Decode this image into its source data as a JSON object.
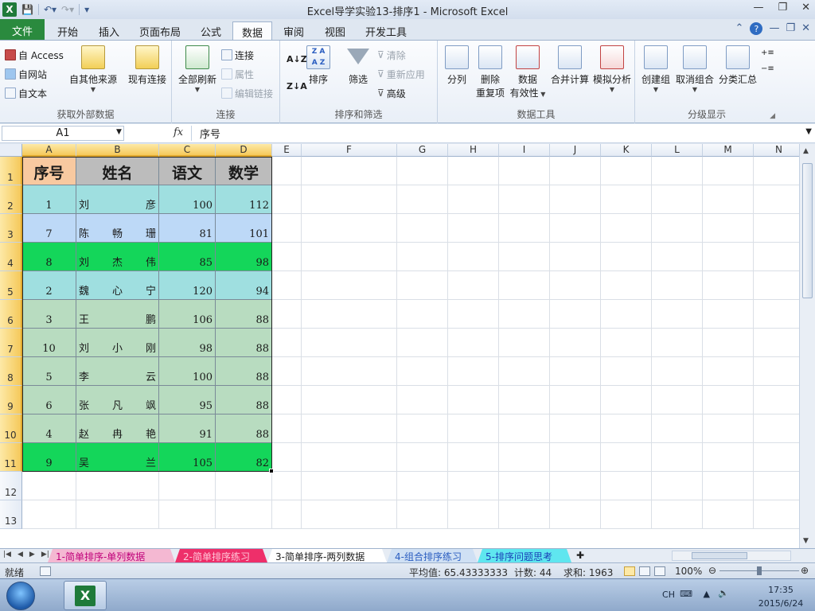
{
  "window": {
    "title": "Excel导学实验13-排序1  -  Microsoft Excel",
    "controls": [
      "—",
      "❐",
      "✕"
    ]
  },
  "ribbon_tabs": [
    "文件",
    "开始",
    "插入",
    "页面布局",
    "公式",
    "数据",
    "审阅",
    "视图",
    "开发工具"
  ],
  "ribbon": {
    "external": {
      "access": "自 Access",
      "web": "自网站",
      "text": "自文本",
      "other": "自其他来源",
      "existing": "现有连接",
      "label": "获取外部数据"
    },
    "connections": {
      "refresh_all": "全部刷新",
      "connections": "连接",
      "properties": "属性",
      "edit_links": "编辑链接",
      "label": "连接"
    },
    "sort_filter": {
      "sort": "排序",
      "filter": "筛选",
      "clear": "清除",
      "reapply": "重新应用",
      "advanced": "高级",
      "label": "排序和筛选"
    },
    "data_tools": {
      "text_to_columns": "分列",
      "remove_dup_1": "删除",
      "remove_dup_2": "重复项",
      "validation_1": "数据",
      "validation_2": "有效性",
      "consolidate": "合并计算",
      "what_if": "模拟分析",
      "label": "数据工具"
    },
    "outline": {
      "group": "创建组",
      "ungroup": "取消组合",
      "subtotal": "分类汇总",
      "label": "分级显示"
    }
  },
  "formula_bar": {
    "name_box": "A1",
    "fx": "fx",
    "content": "序号"
  },
  "columns": [
    "A",
    "B",
    "C",
    "D",
    "E",
    "F",
    "G",
    "H",
    "I",
    "J",
    "K",
    "L",
    "M",
    "N"
  ],
  "rows": [
    "1",
    "2",
    "3",
    "4",
    "5",
    "6",
    "7",
    "8",
    "9",
    "10",
    "11",
    "12",
    "13"
  ],
  "table": {
    "headers": [
      "序号",
      "姓名",
      "语文",
      "数学"
    ],
    "rows": [
      {
        "no": "1",
        "name": [
          "刘",
          "彦"
        ],
        "chinese": "100",
        "math": "112",
        "fill": "#9fdfe0"
      },
      {
        "no": "7",
        "name": [
          "陈",
          "畅",
          "珊"
        ],
        "chinese": "81",
        "math": "101",
        "fill": "#bdd9f7"
      },
      {
        "no": "8",
        "name": [
          "刘",
          "杰",
          "伟"
        ],
        "chinese": "85",
        "math": "98",
        "fill": "#14d65a"
      },
      {
        "no": "2",
        "name": [
          "魏",
          "心",
          "宁"
        ],
        "chinese": "120",
        "math": "94",
        "fill": "#9fdfe0"
      },
      {
        "no": "3",
        "name": [
          "王",
          "鹏"
        ],
        "chinese": "106",
        "math": "88",
        "fill": "#b8dcc0"
      },
      {
        "no": "10",
        "name": [
          "刘",
          "小",
          "刚"
        ],
        "chinese": "98",
        "math": "88",
        "fill": "#b8dcc0"
      },
      {
        "no": "5",
        "name": [
          "李",
          "云"
        ],
        "chinese": "100",
        "math": "88",
        "fill": "#b8dcc0"
      },
      {
        "no": "6",
        "name": [
          "张",
          "凡",
          "飒"
        ],
        "chinese": "95",
        "math": "88",
        "fill": "#b8dcc0"
      },
      {
        "no": "4",
        "name": [
          "赵",
          "冉",
          "艳"
        ],
        "chinese": "91",
        "math": "88",
        "fill": "#b8dcc0"
      },
      {
        "no": "9",
        "name": [
          "吴",
          "兰"
        ],
        "chinese": "105",
        "math": "82",
        "fill": "#14d65a"
      }
    ],
    "header_fills": [
      "#f8c9a0",
      "#bcbcbc",
      "#bcbcbc",
      "#bcbcbc"
    ]
  },
  "sheets": [
    {
      "name": "1-简单排序-单列数据",
      "color": "#f4b8d2",
      "text": "#c0007a"
    },
    {
      "name": "2-简单排序练习",
      "color": "#ee2f6a",
      "text": "#ffc6d8"
    },
    {
      "name": "3-简单排序-两列数据",
      "color": "#ffffff",
      "text": "#1e1e1e"
    },
    {
      "name": "4-组合排序练习",
      "color": "#cfe0f4",
      "text": "#2a5dc0"
    },
    {
      "name": "5-排序问题思考",
      "color": "#5fe6ef",
      "text": "#1a40b8"
    }
  ],
  "status": {
    "ready": "就绪",
    "average": "平均值: 65.43333333",
    "count": "计数: 44",
    "sum": "求和: 1963",
    "zoom": "100%"
  },
  "taskbar": {
    "ime": "CH",
    "time": "17:35",
    "date": "2015/6/24"
  }
}
